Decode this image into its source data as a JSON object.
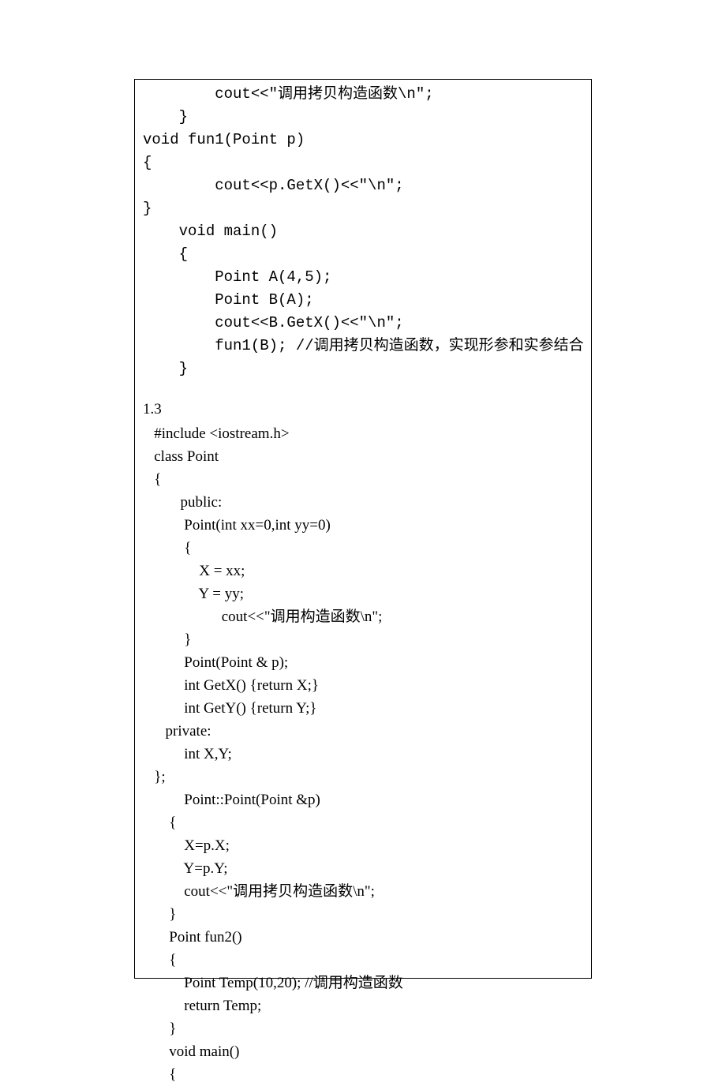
{
  "block1": {
    "lines": [
      "        cout<<\"调用拷贝构造函数\\n\";",
      "    }",
      "void fun1(Point p)",
      "{",
      "        cout<<p.GetX()<<\"\\n\";",
      "}",
      "    void main()",
      "    {",
      "        Point A(4,5);",
      "        Point B(A);",
      "        cout<<B.GetX()<<\"\\n\";",
      "        fun1(B); //调用拷贝构造函数，实现形参和实参结合",
      "    }"
    ]
  },
  "section_label": "1.3",
  "block2": {
    "lines": [
      "   #include <iostream.h>",
      "   class Point",
      "   {",
      "          public:",
      "           Point(int xx=0,int yy=0)",
      "           {",
      "               X = xx;",
      "               Y = yy;",
      "                     cout<<\"调用构造函数\\n\";",
      "           }",
      "           Point(Point & p);",
      "           int GetX() {return X;}",
      "           int GetY() {return Y;}",
      "      private:",
      "           int X,Y;",
      "   };",
      "           Point::Point(Point &p)",
      "       {",
      "           X=p.X;",
      "           Y=p.Y;",
      "           cout<<\"调用拷贝构造函数\\n\";",
      "       }",
      "       Point fun2()",
      "       {",
      "           Point Temp(10,20); //调用构造函数",
      "           return Temp;",
      "       }",
      "       void main()",
      "       {"
    ]
  }
}
